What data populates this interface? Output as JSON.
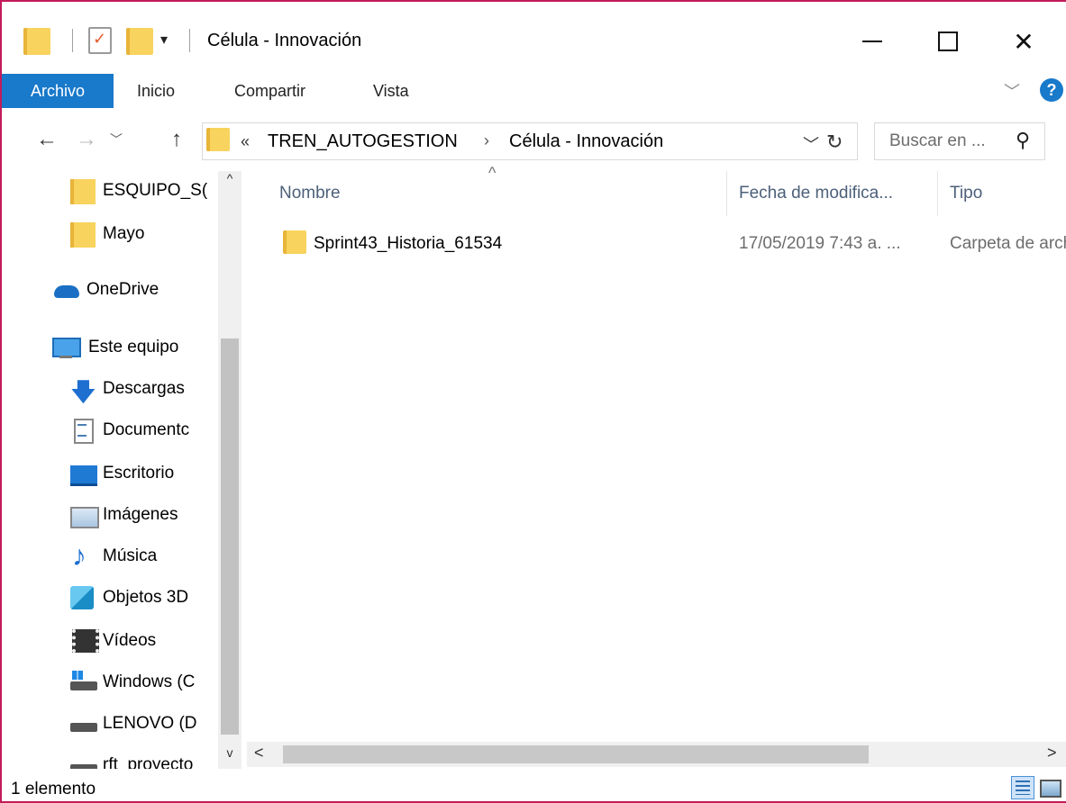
{
  "window": {
    "title": "Célula - Innovación"
  },
  "quick_access": {
    "dropdown_glyph": "▾"
  },
  "ribbon": {
    "tabs": [
      {
        "label": "Archivo"
      },
      {
        "label": "Inicio"
      },
      {
        "label": "Compartir"
      },
      {
        "label": "Vista"
      }
    ]
  },
  "address_bar": {
    "overflow_glyph": "«",
    "path": [
      "TREN_AUTOGESTION",
      "Célula - Innovación"
    ],
    "separator": "›"
  },
  "search": {
    "placeholder": "Buscar en ..."
  },
  "sidebar": {
    "items": [
      {
        "label": "ESQUIPO_S(",
        "icon": "folder-icon"
      },
      {
        "label": "Mayo",
        "icon": "folder-icon"
      },
      {
        "label": "OneDrive",
        "icon": "onedrive-icon"
      },
      {
        "label": "Este equipo",
        "icon": "computer-icon"
      },
      {
        "label": "Descargas",
        "icon": "downloads-icon"
      },
      {
        "label": "Documentc",
        "icon": "documents-icon"
      },
      {
        "label": "Escritorio",
        "icon": "desktop-icon"
      },
      {
        "label": "Imágenes",
        "icon": "pictures-icon"
      },
      {
        "label": "Música",
        "icon": "music-icon"
      },
      {
        "label": "Objetos 3D",
        "icon": "3d-objects-icon"
      },
      {
        "label": "Vídeos",
        "icon": "videos-icon"
      },
      {
        "label": "Windows (C",
        "icon": "windows-drive-icon"
      },
      {
        "label": "LENOVO (D",
        "icon": "drive-icon"
      },
      {
        "label": "rft_proyecto",
        "icon": "network-drive-icon"
      }
    ]
  },
  "columns": {
    "name": "Nombre",
    "date": "Fecha de modifica...",
    "type": "Tipo"
  },
  "files": [
    {
      "name": "Sprint43_Historia_61534",
      "date": "17/05/2019 7:43 a. ...",
      "type": "Carpeta de archivos"
    }
  ],
  "status": {
    "count": "1 elemento"
  },
  "colors": {
    "accent": "#1979ca",
    "folder": "#f8d35e",
    "window_border": "#c21c5b"
  }
}
